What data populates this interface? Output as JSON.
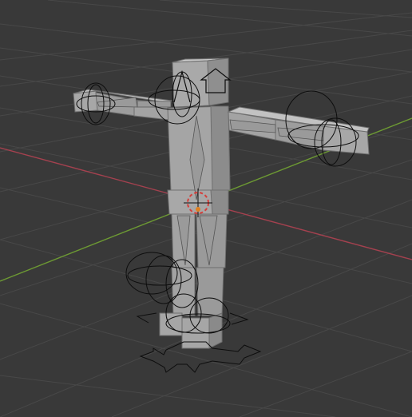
{
  "viewport": {
    "label": "3D Viewport",
    "background_color": "#393939",
    "grid_color": "#4a4a4a",
    "x_axis_color": "#a4414f",
    "y_axis_color": "#6d9a33"
  },
  "scene": {
    "object": "armature-rigged-character",
    "mesh_color": "#a7a7a7",
    "bone_color": "#9a9a9a",
    "control_color": "#0d0d0d",
    "cursor_color": "#d5403c"
  },
  "controls": [
    {
      "name": "left-hand-rotation-control",
      "icon": "rotation-circles"
    },
    {
      "name": "right-hand-rotation-control",
      "icon": "rotation-circles"
    },
    {
      "name": "head-rotation-control",
      "icon": "rotation-circles"
    },
    {
      "name": "head-up-arrow-control",
      "icon": "arrow-up"
    },
    {
      "name": "knee-rotation-control",
      "icon": "rotation-circles"
    },
    {
      "name": "foot-rotation-control",
      "icon": "rotation-circles"
    },
    {
      "name": "root-move-arrows-control",
      "icon": "four-way-arrows"
    }
  ]
}
